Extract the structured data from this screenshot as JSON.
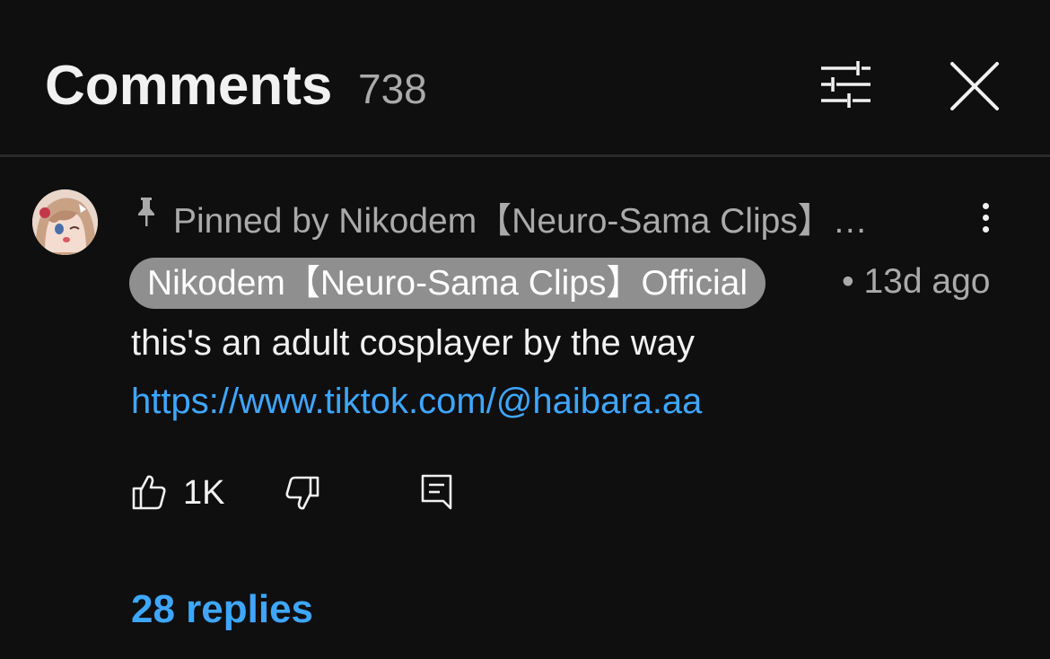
{
  "header": {
    "title": "Comments",
    "count": "738",
    "filter_icon": "sliders-icon",
    "close_icon": "close-icon"
  },
  "comment": {
    "avatar_icon": "avatar-image",
    "pin_icon": "pin-icon",
    "pinned_text": "Pinned by Nikodem【Neuro-Sama Clips】…",
    "more_icon": "more-vertical-icon",
    "author": "Nikodem【Neuro-Sama Clips】Official",
    "time": "• 13d ago",
    "text": "this's an adult cosplayer by the way",
    "link": "https://www.tiktok.com/@haibara.aa",
    "likes": "1K",
    "like_icon": "thumbs-up-icon",
    "dislike_icon": "thumbs-down-icon",
    "reply_icon": "reply-icon",
    "replies_label": "28 replies"
  },
  "colors": {
    "background": "#0f0f0f",
    "link": "#3ea6ff",
    "secondary_text": "#aaaaaa",
    "badge": "#8f8f8f"
  }
}
